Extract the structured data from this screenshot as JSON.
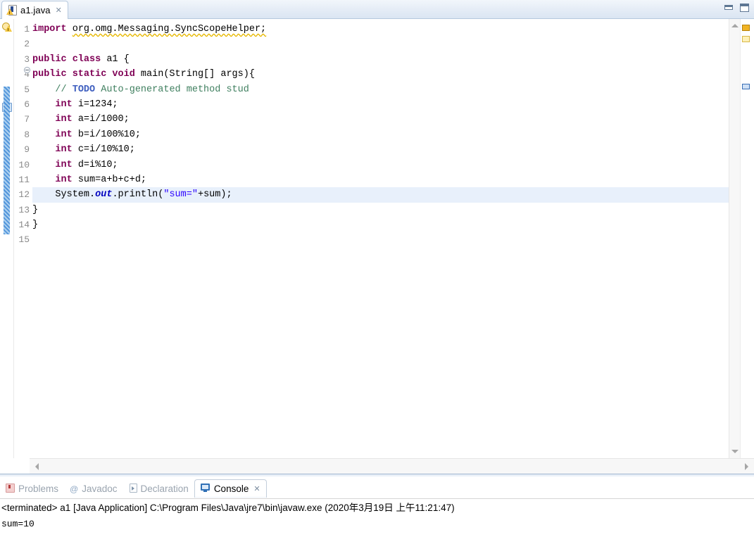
{
  "window": {
    "minimize_label": "Minimize",
    "maximize_label": "Maximize"
  },
  "editor": {
    "tab": {
      "filename": "a1.java",
      "close": "✕",
      "icon": "java-file-warning-icon"
    },
    "gutter": {
      "warning_icon": "warning-lightbulb-icon",
      "todo_icon": "todo-task-icon",
      "fold_icon": "fold-collapse-icon"
    },
    "line_numbers": [
      "1",
      "2",
      "3",
      "4",
      "5",
      "6",
      "7",
      "8",
      "9",
      "10",
      "11",
      "12",
      "13",
      "14",
      "15"
    ],
    "current_line": 12,
    "lines": [
      {
        "n": 1,
        "tokens": [
          {
            "t": "import",
            "c": "kw"
          },
          {
            "t": " ",
            "c": "plain"
          },
          {
            "t": "org.omg.Messaging.SyncScopeHelper;",
            "c": "plain unused"
          }
        ]
      },
      {
        "n": 2,
        "tokens": []
      },
      {
        "n": 3,
        "tokens": [
          {
            "t": "public class",
            "c": "kw"
          },
          {
            "t": " a1 {",
            "c": "plain"
          }
        ]
      },
      {
        "n": 4,
        "tokens": [
          {
            "t": "public static void",
            "c": "kw"
          },
          {
            "t": " main(String[] args){",
            "c": "plain"
          }
        ]
      },
      {
        "n": 5,
        "tokens": [
          {
            "t": "    // ",
            "c": "cmt"
          },
          {
            "t": "TODO",
            "c": "todo"
          },
          {
            "t": " Auto-generated method stud",
            "c": "cmt"
          }
        ]
      },
      {
        "n": 6,
        "tokens": [
          {
            "t": "    ",
            "c": "plain"
          },
          {
            "t": "int",
            "c": "kw"
          },
          {
            "t": " i=1234;",
            "c": "plain"
          }
        ]
      },
      {
        "n": 7,
        "tokens": [
          {
            "t": "    ",
            "c": "plain"
          },
          {
            "t": "int",
            "c": "kw"
          },
          {
            "t": " a=i/1000;",
            "c": "plain"
          }
        ]
      },
      {
        "n": 8,
        "tokens": [
          {
            "t": "    ",
            "c": "plain"
          },
          {
            "t": "int",
            "c": "kw"
          },
          {
            "t": " b=i/100%10;",
            "c": "plain"
          }
        ]
      },
      {
        "n": 9,
        "tokens": [
          {
            "t": "    ",
            "c": "plain"
          },
          {
            "t": "int",
            "c": "kw"
          },
          {
            "t": " c=i/10%10;",
            "c": "plain"
          }
        ]
      },
      {
        "n": 10,
        "tokens": [
          {
            "t": "    ",
            "c": "plain"
          },
          {
            "t": "int",
            "c": "kw"
          },
          {
            "t": " d=i%10;",
            "c": "plain"
          }
        ]
      },
      {
        "n": 11,
        "tokens": [
          {
            "t": "    ",
            "c": "plain"
          },
          {
            "t": "int",
            "c": "kw"
          },
          {
            "t": " sum=a+b+c+d;",
            "c": "plain"
          }
        ]
      },
      {
        "n": 12,
        "tokens": [
          {
            "t": "    System.",
            "c": "plain"
          },
          {
            "t": "out",
            "c": "fld"
          },
          {
            "t": ".println(",
            "c": "plain"
          },
          {
            "t": "\"sum=\"",
            "c": "str"
          },
          {
            "t": "+sum);",
            "c": "plain"
          }
        ]
      },
      {
        "n": 13,
        "tokens": [
          {
            "t": "}",
            "c": "plain"
          }
        ]
      },
      {
        "n": 14,
        "tokens": [
          {
            "t": "}",
            "c": "plain"
          }
        ]
      },
      {
        "n": 15,
        "tokens": []
      }
    ],
    "overview_markers": [
      {
        "kind": "warning",
        "name": "overview-warning-marker"
      },
      {
        "kind": "todo",
        "name": "overview-todo-marker"
      },
      {
        "kind": "cursor",
        "name": "overview-cursor-marker"
      }
    ]
  },
  "bottom_panel": {
    "tabs": [
      {
        "label": "Problems",
        "icon": "problems-icon",
        "active": false
      },
      {
        "label": "Javadoc",
        "icon": "javadoc-icon",
        "active": false
      },
      {
        "label": "Declaration",
        "icon": "declaration-icon",
        "active": false
      },
      {
        "label": "Console",
        "icon": "console-icon",
        "active": true,
        "close": "✕"
      }
    ],
    "console": {
      "header": "<terminated> a1 [Java Application] C:\\Program Files\\Java\\jre7\\bin\\javaw.exe (2020年3月19日 上午11:21:47)",
      "output": "sum=10"
    }
  },
  "colors": {
    "keyword": "#7f0055",
    "comment": "#3f7f5f",
    "todo": "#3f5fbf",
    "string": "#2a00ff",
    "field": "#0000c0",
    "current_line_bg": "#e8f0fb",
    "tab_strip": "#dae5f2"
  }
}
